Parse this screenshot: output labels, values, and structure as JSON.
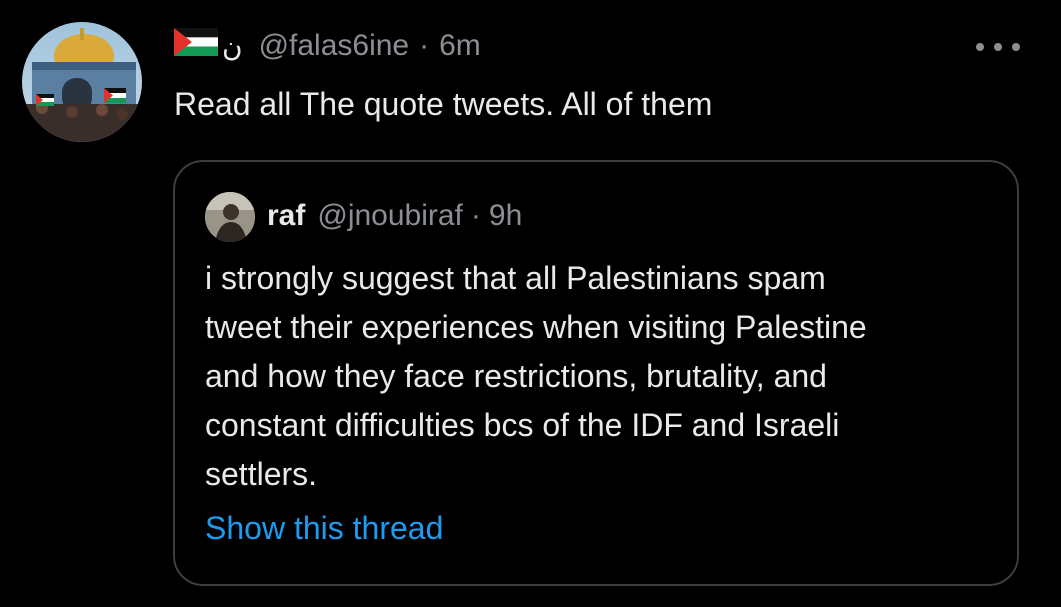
{
  "tweet": {
    "display_name": "ن",
    "handle": "@falas6ine",
    "separator": "·",
    "time": "6m",
    "text": "Read all The quote tweets. All of them"
  },
  "quoted_tweet": {
    "display_name": "raf",
    "handle": "@jnoubiraf",
    "separator": "·",
    "time": "9h",
    "text_lines": [
      "i strongly suggest that all Palestinians spam",
      "tweet their experiences when visiting Palestine",
      "and how they face restrictions, brutality, and",
      "constant difficulties bcs of the IDF and Israeli",
      "settlers."
    ],
    "show_thread_label": "Show this thread"
  },
  "icons": {
    "flag": "palestine-flag-icon",
    "more": "more-options-icon"
  },
  "colors": {
    "background": "#000000",
    "primary_text": "#e7e9ea",
    "secondary_text": "#8b8f94",
    "link": "#1d9bf0",
    "border": "#3a3d41"
  }
}
